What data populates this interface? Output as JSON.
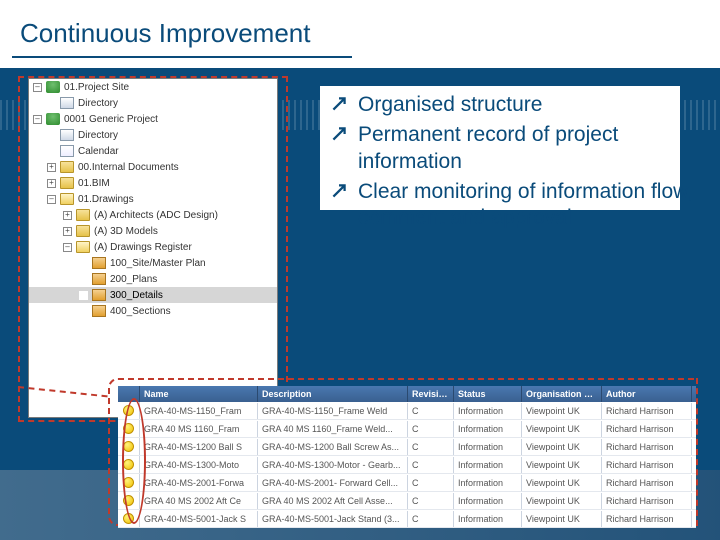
{
  "title": "Continuous Improvement",
  "tree": {
    "items": [
      {
        "indent": 0,
        "exp": "–",
        "icon": "db",
        "label": "01.Project Site"
      },
      {
        "indent": 1,
        "exp": "",
        "icon": "dir",
        "label": "Directory"
      },
      {
        "indent": 0,
        "exp": "–",
        "icon": "db",
        "label": "0001 Generic Project"
      },
      {
        "indent": 1,
        "exp": "",
        "icon": "dir",
        "label": "Directory"
      },
      {
        "indent": 1,
        "exp": "",
        "icon": "cal",
        "label": "Calendar"
      },
      {
        "indent": 1,
        "exp": "+",
        "icon": "folder",
        "label": "00.Internal Documents"
      },
      {
        "indent": 1,
        "exp": "+",
        "icon": "folder",
        "label": "01.BIM"
      },
      {
        "indent": 1,
        "exp": "–",
        "icon": "folder-open",
        "label": "01.Drawings"
      },
      {
        "indent": 2,
        "exp": "+",
        "icon": "folder",
        "label": "(A) Architects (ADC Design)"
      },
      {
        "indent": 2,
        "exp": "+",
        "icon": "folder",
        "label": "(A) 3D Models"
      },
      {
        "indent": 2,
        "exp": "–",
        "icon": "folder-open",
        "label": "(A) Drawings Register"
      },
      {
        "indent": 3,
        "exp": "",
        "icon": "plan",
        "label": "100_Site/Master Plan"
      },
      {
        "indent": 3,
        "exp": "",
        "icon": "plan",
        "label": "200_Plans"
      },
      {
        "indent": 3,
        "exp": "",
        "icon": "plan",
        "label": "300_Details",
        "sel": true
      },
      {
        "indent": 3,
        "exp": "",
        "icon": "plan",
        "label": "400_Sections"
      }
    ]
  },
  "bullets": [
    "Organised structure",
    "Permanent record of project information",
    "Clear monitoring of information flow, comment and approval"
  ],
  "table": {
    "headers": [
      "Name",
      "Description",
      "Revision",
      "Status",
      "Organisation Name",
      "Author"
    ],
    "rows": [
      {
        "name": "GRA-40-MS-1150_Fram",
        "desc": "GRA-40-MS-1150_Frame Weld",
        "rev": "C",
        "status": "Information",
        "org": "Viewpoint UK",
        "author": "Richard Harrison"
      },
      {
        "name": "GRA 40 MS 1160_Fram",
        "desc": "GRA 40 MS 1160_Frame Weld...",
        "rev": "C",
        "status": "Information",
        "org": "Viewpoint UK",
        "author": "Richard Harrison"
      },
      {
        "name": "GRA-40-MS-1200 Ball S",
        "desc": "GRA-40-MS-1200 Ball Screw As...",
        "rev": "C",
        "status": "Information",
        "org": "Viewpoint UK",
        "author": "Richard Harrison"
      },
      {
        "name": "GRA-40-MS-1300-Moto",
        "desc": "GRA-40-MS-1300-Motor - Gearb...",
        "rev": "C",
        "status": "Information",
        "org": "Viewpoint UK",
        "author": "Richard Harrison"
      },
      {
        "name": "GRA-40-MS-2001-Forwa",
        "desc": "GRA-40-MS-2001- Forward Cell...",
        "rev": "C",
        "status": "Information",
        "org": "Viewpoint UK",
        "author": "Richard Harrison"
      },
      {
        "name": "GRA 40 MS 2002 Aft Ce",
        "desc": "GRA 40 MS 2002 Aft Cell Asse...",
        "rev": "C",
        "status": "Information",
        "org": "Viewpoint UK",
        "author": "Richard Harrison"
      },
      {
        "name": "GRA-40-MS-5001-Jack S",
        "desc": "GRA-40-MS-5001-Jack Stand (3...",
        "rev": "C",
        "status": "Information",
        "org": "Viewpoint UK",
        "author": "Richard Harrison"
      }
    ]
  }
}
